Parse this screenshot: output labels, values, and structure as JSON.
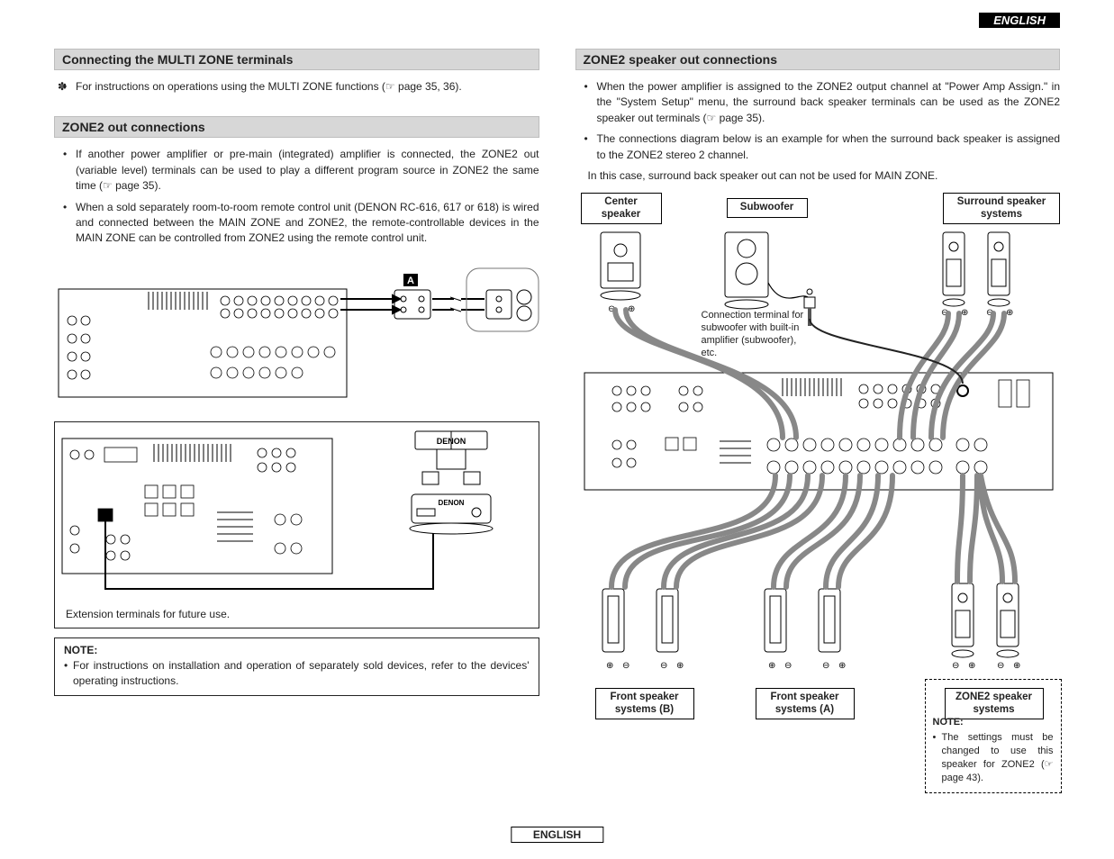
{
  "language_tab": "ENGLISH",
  "footer_lang": "ENGLISH",
  "left": {
    "h1": "Connecting the MULTI ZONE terminals",
    "intro_bullet": "For instructions on operations using the MULTI ZONE functions (☞ page 35, 36).",
    "h2": "ZONE2 out connections",
    "bullets": [
      "If another power amplifier or pre-main (integrated) amplifier is connected, the ZONE2 out (variable level) terminals can be used to play a different program source in ZONE2 the same time (☞ page 35).",
      "When a sold separately room-to-room remote control unit (DENON RC-616, 617 or 618) is wired and connected between the MAIN ZONE and ZONE2, the remote-controllable devices in the MAIN ZONE can be controlled from ZONE2 using the remote control unit."
    ],
    "diagram_tag_A": "A",
    "diagram_brand": "DENON",
    "ext_label": "Extension terminals for future use.",
    "note_title": "NOTE:",
    "note_bullet": "For instructions on installation and operation of separately sold devices, refer to the devices' operating instructions."
  },
  "right": {
    "h1": "ZONE2 speaker out connections",
    "bullets": [
      "When the power amplifier is assigned to the ZONE2 output channel at \"Power Amp Assign.\" in the \"System Setup\" menu, the surround back speaker terminals can be used as the ZONE2 speaker out terminals (☞ page 35).",
      "The connections diagram below is an example for when the surround back speaker is assigned to the ZONE2 stereo 2 channel."
    ],
    "followup": "In this case, surround back speaker out can not be used for MAIN ZONE.",
    "labels": {
      "center": "Center speaker",
      "sub": "Subwoofer",
      "surround": "Surround speaker systems",
      "sub_note": "Connection terminal for subwoofer with built-in amplifier (subwoofer), etc.",
      "front_b": "Front speaker systems (B)",
      "front_a": "Front speaker systems (A)",
      "zone2": "ZONE2 speaker systems"
    },
    "note_title": "NOTE:",
    "note_text": "The settings must be changed to use this speaker for ZONE2 (☞ page 43)."
  }
}
